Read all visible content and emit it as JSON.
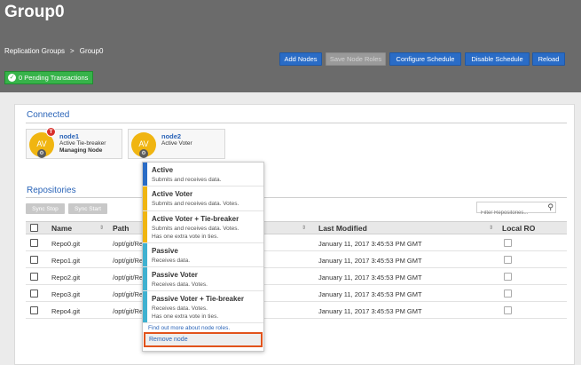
{
  "header": {
    "title": "Group0",
    "breadcrumb": [
      "Replication Groups",
      ">",
      "Group0"
    ],
    "pending": "0 Pending Transactions"
  },
  "toolbar": {
    "add_nodes": "Add Nodes",
    "save_node_roles": "Save Node Roles",
    "configure_schedule": "Configure Schedule",
    "disable_schedule": "Disable Schedule",
    "reload": "Reload"
  },
  "connected": {
    "title": "Connected",
    "nodes": [
      {
        "avatar": "AV",
        "badge": "T",
        "name": "node1",
        "role": "Active Tie-breaker",
        "status": "Managing Node"
      },
      {
        "avatar": "AV",
        "name": "node2",
        "role": "Active Voter"
      }
    ]
  },
  "repositories": {
    "title": "Repositories",
    "sync_stop": "Sync Stop",
    "sync_start": "Sync Start",
    "filter_placeholder": "Filter Repositories...",
    "columns": [
      "Name",
      "Path",
      "Last Modified",
      "Local RO"
    ],
    "rows": [
      {
        "name": "Repo0.git",
        "path": "/opt/git/Re",
        "modified": "January 11, 2017 3:45:53 PM GMT"
      },
      {
        "name": "Repo1.git",
        "path": "/opt/git/Re",
        "modified": "January 11, 2017 3:45:53 PM GMT"
      },
      {
        "name": "Repo2.git",
        "path": "/opt/git/Re",
        "modified": "January 11, 2017 3:45:53 PM GMT"
      },
      {
        "name": "Repo3.git",
        "path": "/opt/git/Re",
        "modified": "January 11, 2017 3:45:53 PM GMT"
      },
      {
        "name": "Repo4.git",
        "path": "/opt/git/Re",
        "modified": "January 11, 2017 3:45:53 PM GMT"
      }
    ]
  },
  "role_menu": {
    "options": [
      {
        "title": "Active",
        "lines": [
          "Submits and receives data."
        ],
        "color": "#2a6cc6"
      },
      {
        "title": "Active Voter",
        "lines": [
          "Submits and receives data. Votes."
        ],
        "color": "#f0b511"
      },
      {
        "title": "Active Voter + Tie-breaker",
        "lines": [
          "Submits and receives data. Votes.",
          "Has one extra vote in ties."
        ],
        "color": "#f0b511"
      },
      {
        "title": "Passive",
        "lines": [
          "Receives data."
        ],
        "color": "#3fb1d0"
      },
      {
        "title": "Passive Voter",
        "lines": [
          "Receives data. Votes."
        ],
        "color": "#3fb1d0"
      },
      {
        "title": "Passive Voter + Tie-breaker",
        "lines": [
          "Receives data. Votes.",
          "Has one extra vote in ties."
        ],
        "color": "#3fb1d0"
      }
    ],
    "learn_more": "Find out more about node roles.",
    "remove": "Remove node"
  },
  "icons": {
    "pending": "check-circle-icon",
    "filter": "search-icon",
    "avatar": "gear-icon",
    "badge": "tie-breaker-badge-icon"
  },
  "colors": {
    "header": "#6b6b6b",
    "primary_button": "#2a6cc6",
    "pending": "#37b34a",
    "highlight": "#e2531c"
  }
}
